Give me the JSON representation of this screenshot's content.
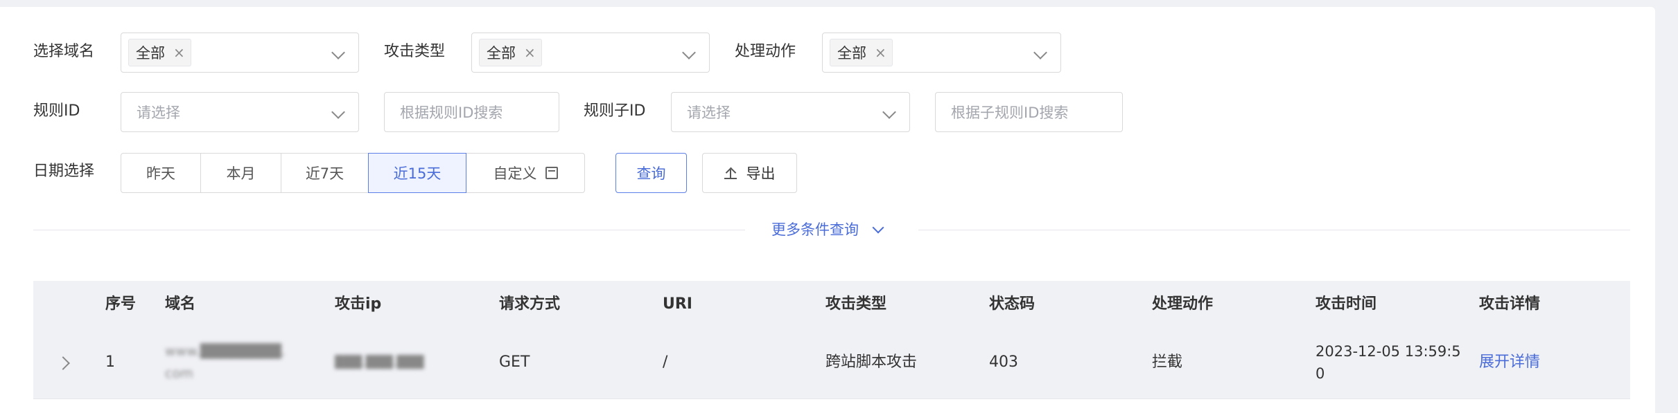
{
  "filters": {
    "domain_label": "选择域名",
    "domain_tag": "全部",
    "attack_type_label": "攻击类型",
    "attack_type_tag": "全部",
    "action_label": "处理动作",
    "action_tag": "全部",
    "rule_id_label": "规则ID",
    "rule_id_placeholder": "请选择",
    "rule_search_placeholder": "根据规则ID搜索",
    "sub_rule_id_label": "规则子ID",
    "sub_rule_id_placeholder": "请选择",
    "sub_rule_search_placeholder": "根据子规则ID搜索",
    "date_label": "日期选择",
    "date_options": [
      "昨天",
      "本月",
      "近7天",
      "近15天",
      "自定义"
    ],
    "date_selected": "近15天",
    "query_button": "查询",
    "export_button": "导出",
    "more_conditions": "更多条件查询"
  },
  "table": {
    "columns": [
      "序号",
      "域名",
      "攻击ip",
      "请求方式",
      "URI",
      "攻击类型",
      "状态码",
      "处理动作",
      "攻击时间",
      "攻击详情"
    ],
    "rows": [
      {
        "index": "1",
        "domain_line1": "www.████████.",
        "domain_line2": "com",
        "ip": "███.███.███",
        "method": "GET",
        "uri": "/",
        "attack_type": "跨站脚本攻击",
        "status": "403",
        "action": "拦截",
        "time_line1": "2023-12-05 13:59:5",
        "time_line2": "0",
        "detail": "展开详情"
      }
    ]
  },
  "colors": {
    "accent": "#4a6cd8",
    "background": "#f0f1f5",
    "panel": "#ffffff"
  }
}
